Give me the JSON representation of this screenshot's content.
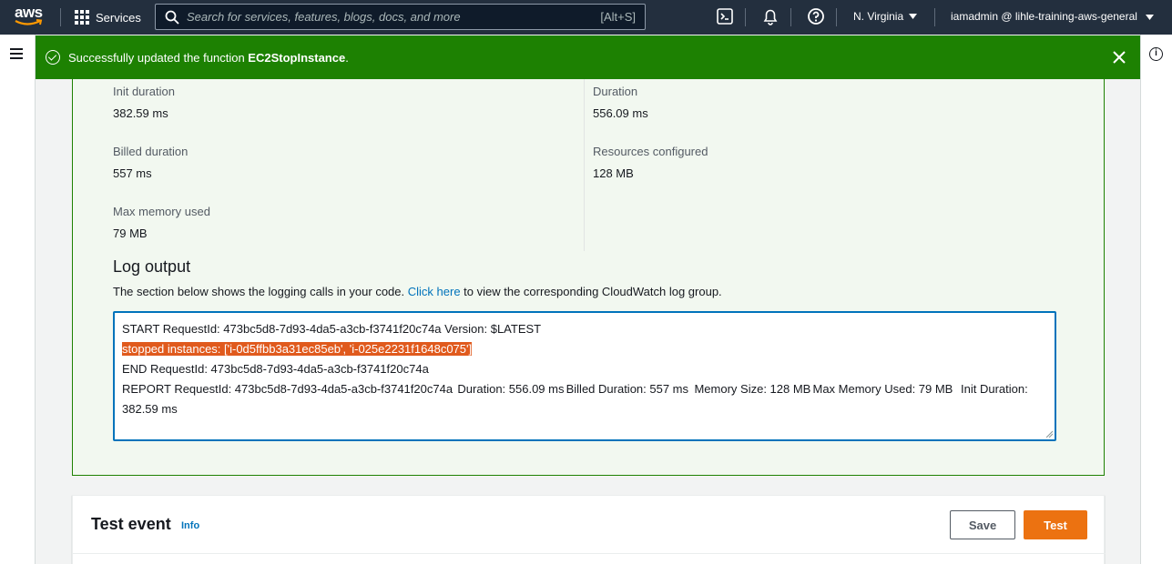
{
  "topnav": {
    "logo_text": "aws",
    "services_label": "Services",
    "search_placeholder": "Search for services, features, blogs, docs, and more",
    "search_shortcut": "[Alt+S]",
    "region": "N. Virginia",
    "account": "iamadmin @ lihle-training-aws-general"
  },
  "flash": {
    "prefix": "Successfully updated the function ",
    "function_name": "EC2StopInstance",
    "suffix": "."
  },
  "details": {
    "init_duration_label": "Init duration",
    "init_duration_value": "382.59 ms",
    "duration_label": "Duration",
    "duration_value": "556.09 ms",
    "billed_duration_label": "Billed duration",
    "billed_duration_value": "557 ms",
    "resources_label": "Resources configured",
    "resources_value": "128 MB",
    "max_memory_label": "Max memory used",
    "max_memory_value": "79 MB"
  },
  "log_output": {
    "title": "Log output",
    "desc_before": "The section below shows the logging calls in your code. ",
    "desc_link": "Click here",
    "desc_after": " to view the corresponding CloudWatch log group.",
    "line1": "START RequestId: 473bc5d8-7d93-4da5-a3cb-f3741f20c74a Version: $LATEST",
    "line2": "stopped instances: ['i-0d5ffbb3a31ec85eb', 'i-025e2231f1648c075']",
    "line3": "END RequestId: 473bc5d8-7d93-4da5-a3cb-f3741f20c74a",
    "line4": "REPORT RequestId: 473bc5d8-7d93-4da5-a3cb-f3741f20c74a\tDuration: 556.09 ms\tBilled Duration: 557 ms\tMemory Size: 128 MB\tMax Memory Used: 79 MB\tInit Duration: 382.59 ms"
  },
  "test_event": {
    "title": "Test event",
    "info_label": "Info",
    "save_label": "Save",
    "test_label": "Test"
  },
  "colors": {
    "nav_bg": "#232f3e",
    "success_green": "#1d8102",
    "primary_orange": "#ec7211",
    "link_blue": "#0073bb"
  }
}
